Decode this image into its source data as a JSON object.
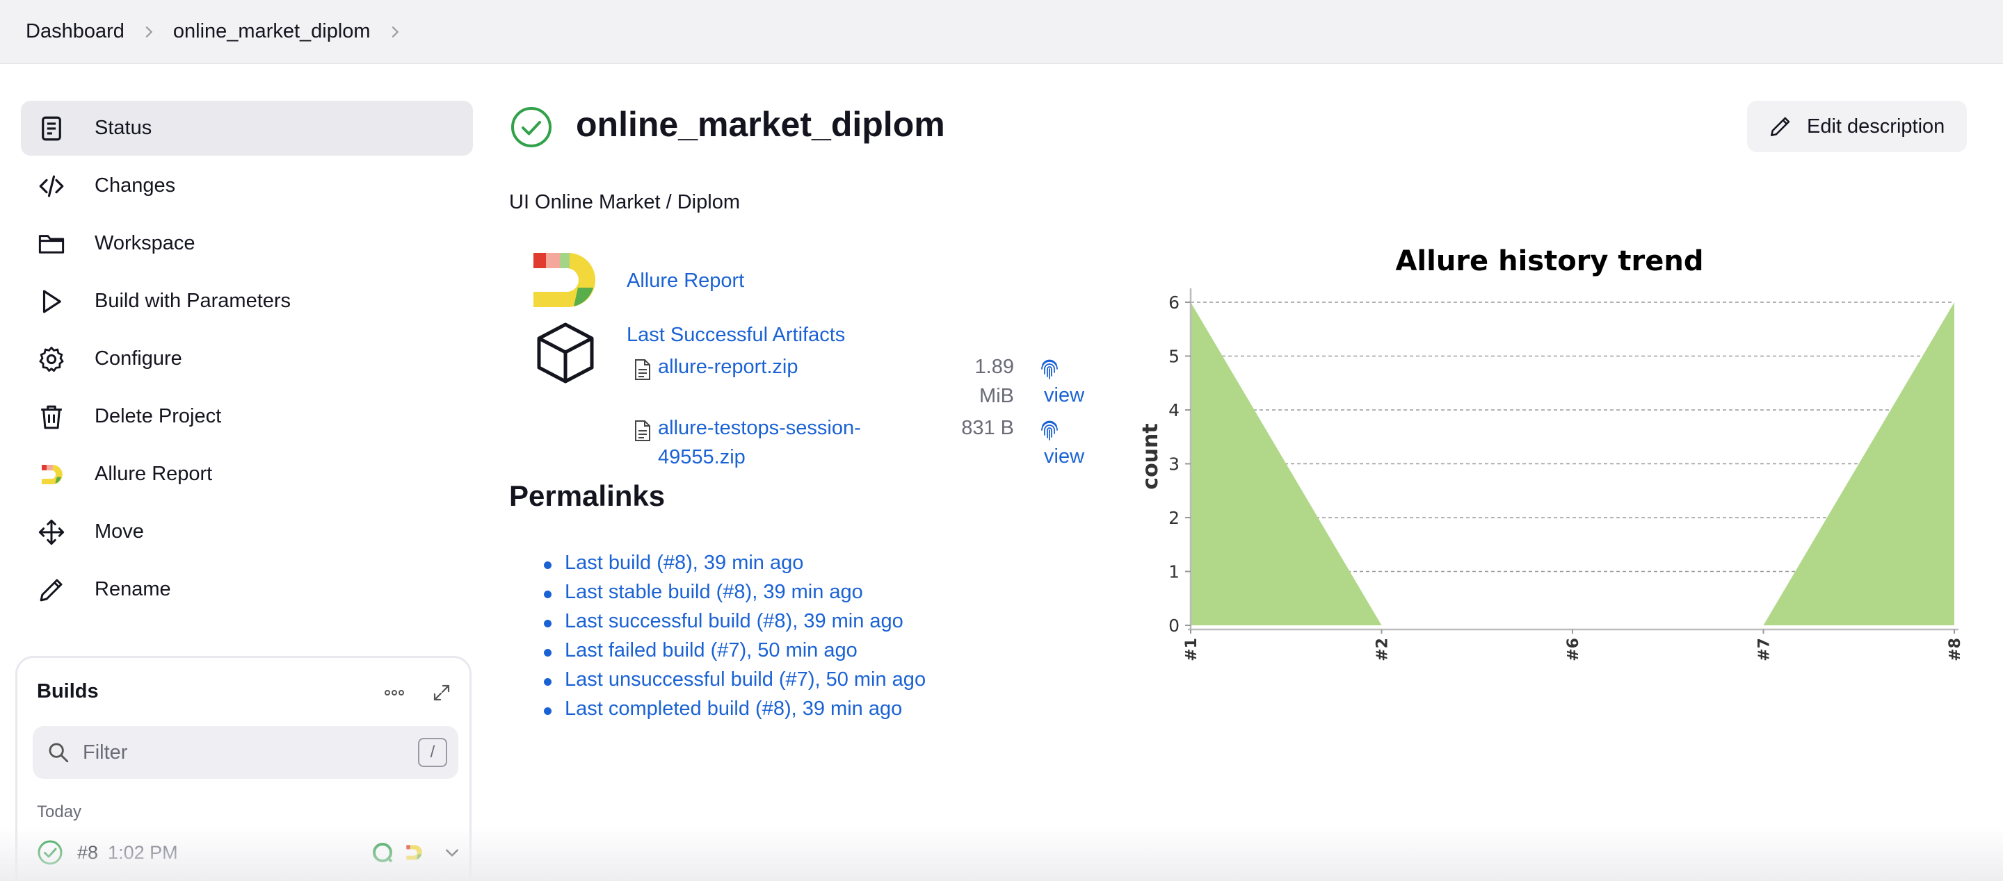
{
  "breadcrumb": {
    "items": [
      "Dashboard",
      "online_market_diplom"
    ]
  },
  "sidebar": {
    "items": [
      {
        "label": "Status",
        "icon": "document-icon",
        "active": true
      },
      {
        "label": "Changes",
        "icon": "code-icon"
      },
      {
        "label": "Workspace",
        "icon": "folder-icon"
      },
      {
        "label": "Build with Parameters",
        "icon": "play-icon"
      },
      {
        "label": "Configure",
        "icon": "gear-icon"
      },
      {
        "label": "Delete Project",
        "icon": "trash-icon"
      },
      {
        "label": "Allure Report",
        "icon": "allure-logo-icon"
      },
      {
        "label": "Move",
        "icon": "move-arrows-icon"
      },
      {
        "label": "Rename",
        "icon": "pencil-icon"
      }
    ]
  },
  "builds": {
    "title": "Builds",
    "filter_placeholder": "Filter",
    "filter_shortcut": "/",
    "group_label": "Today",
    "rows": [
      {
        "number": "#8",
        "time": "1:02 PM",
        "status": "success"
      }
    ]
  },
  "job": {
    "title": "online_market_diplom",
    "status": "success",
    "edit_label": "Edit description",
    "description": "UI Online Market / Diplom"
  },
  "links": {
    "allure_report": "Allure Report",
    "last_successful_artifacts": "Last Successful Artifacts"
  },
  "artifacts": [
    {
      "name_line1": "allure-report.zip",
      "name_line2": "",
      "size_line1": "1.89",
      "size_line2": "MiB",
      "view": "view"
    },
    {
      "name_line1": "allure-testops-session-",
      "name_line2": "49555.zip",
      "size_line1": "831 B",
      "size_line2": "",
      "view": "view"
    }
  ],
  "permalinks": {
    "heading": "Permalinks",
    "items": [
      "Last build (#8), 39 min ago",
      "Last stable build (#8), 39 min ago",
      "Last successful build (#8), 39 min ago",
      "Last failed build (#7), 50 min ago",
      "Last unsuccessful build (#7), 50 min ago",
      "Last completed build (#8), 39 min ago"
    ]
  },
  "colors": {
    "link": "#1a62d4",
    "success": "#31a14a",
    "trend_fill": "#b1d889",
    "allure_red": "#e13b2f",
    "allure_yellow": "#f2d83a",
    "allure_green": "#5aad4b"
  },
  "chart_data": {
    "type": "area",
    "title": "Allure history trend",
    "xlabel": "",
    "ylabel": "count",
    "categories": [
      "#1",
      "#2",
      "#6",
      "#7",
      "#8"
    ],
    "series": [
      {
        "values": [
          6,
          0,
          0,
          0,
          6
        ]
      }
    ],
    "ylim": [
      0,
      6
    ],
    "yticks": [
      0,
      1,
      2,
      3,
      4,
      5,
      6
    ],
    "grid": true
  }
}
